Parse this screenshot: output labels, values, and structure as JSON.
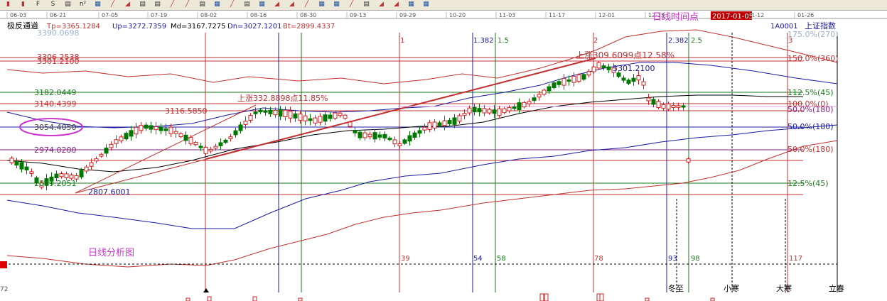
{
  "toolbar": {
    "icons": [
      "candle-icon",
      "candle-icon",
      "F-icon",
      "S-icon",
      "chart-icon",
      "n2-icon",
      "grid-icon",
      "draw-icon",
      "fan-icon",
      "chart-icon",
      "chart-icon",
      "draw-icon",
      "draw-icon",
      "chart-icon",
      "grid-icon",
      "draw-icon",
      "chart-icon",
      "grid-icon",
      "fan-icon",
      "fan-icon",
      "draw-icon",
      "grid-icon",
      "grid-icon",
      "draw-icon",
      "chart-icon",
      "fan-icon",
      "fan-icon",
      "grid-icon",
      "grid-icon"
    ],
    "labels": {
      "F": "F",
      "S": "S",
      "n2": "n²"
    }
  },
  "time_axis": [
    "06-03",
    "06-21",
    "07-05",
    "07-19",
    "08-02",
    "08-16",
    "08-30",
    "09-13",
    "09-29",
    "10-20",
    "11-03",
    "11-17",
    "12-01",
    "12-15",
    "01-12",
    "01-26"
  ],
  "info_bar": {
    "name": "极反通道",
    "tp": "Tp=3365.1284",
    "up": "Up=3272.7359",
    "md": "Md=3167.7275",
    "dn": "Dn=3027.1201",
    "bt": "Bt=2899.4337",
    "code": "1A0001",
    "index_name": "上证指数"
  },
  "annotations": {
    "time_point": "日线时间点",
    "date_badge": "2017-01-05",
    "chart_name": "日线分析图"
  },
  "chart_data": {
    "type": "candlestick",
    "price_labels": [
      {
        "text": "3390.0698",
        "color": "#9ab0d0"
      },
      {
        "text": "3306.2538",
        "color": "#c03030"
      },
      {
        "text": "3301.2100",
        "color": "#c03030"
      },
      {
        "text": "3182.0449",
        "color": "#1a7a1a"
      },
      {
        "text": "3140.4399",
        "color": "#c03030"
      },
      {
        "text": "3116.5850",
        "color": "#c03030"
      },
      {
        "text": "3054.4050",
        "color": "#404040"
      },
      {
        "text": "2974.0200",
        "color": "#802080"
      },
      {
        "text": "2849.2051",
        "color": "#1a7a1a"
      },
      {
        "text": "2807.6001",
        "color": "#1a1aa0"
      },
      {
        "text": "3301.2100",
        "color": "#1a1aa0"
      }
    ],
    "right_labels": [
      {
        "text": "175.0%(270)",
        "color": "#9ab0d0"
      },
      {
        "text": "150.0%(360)",
        "color": "#c03030"
      },
      {
        "text": "112.5%(45)",
        "color": "#1a7a1a"
      },
      {
        "text": "100.0%(0)",
        "color": "#c03030"
      },
      {
        "text": "50.0%(180)",
        "color": "#802080"
      },
      {
        "text": "50.0%(180)",
        "color": "#1a1aa0"
      },
      {
        "text": "50.0%(180)",
        "color": "#c03030"
      },
      {
        "text": "12.5%(45)",
        "color": "#1a7a1a"
      }
    ],
    "rise_labels": [
      {
        "text": "上涨332.8898点11.85%",
        "color": "#c03030"
      },
      {
        "text": "上涨309.6099点12.58%",
        "color": "#c03030"
      }
    ],
    "fib_top": [
      {
        "text": "1",
        "color": "#c03030"
      },
      {
        "text": "1.382",
        "color": "#1a1aa0"
      },
      {
        "text": "1.5",
        "color": "#1a7a1a"
      },
      {
        "text": "2",
        "color": "#c03030"
      },
      {
        "text": "2.382",
        "color": "#1a1aa0"
      },
      {
        "text": "2.5",
        "color": "#1a7a1a"
      },
      {
        "text": "3",
        "color": "#c03030"
      }
    ],
    "day_counts": [
      {
        "text": "39",
        "color": "#c03030"
      },
      {
        "text": "54",
        "color": "#1a1aa0"
      },
      {
        "text": "58",
        "color": "#1a7a1a"
      },
      {
        "text": "78",
        "color": "#c03030"
      },
      {
        "text": "93",
        "color": "#1a1aa0"
      },
      {
        "text": "98",
        "color": "#1a7a1a"
      },
      {
        "text": "117",
        "color": "#c03030"
      }
    ],
    "solar_terms": [
      "冬至",
      "小寒",
      "大寒",
      "立春"
    ],
    "bottom_left": "72"
  }
}
